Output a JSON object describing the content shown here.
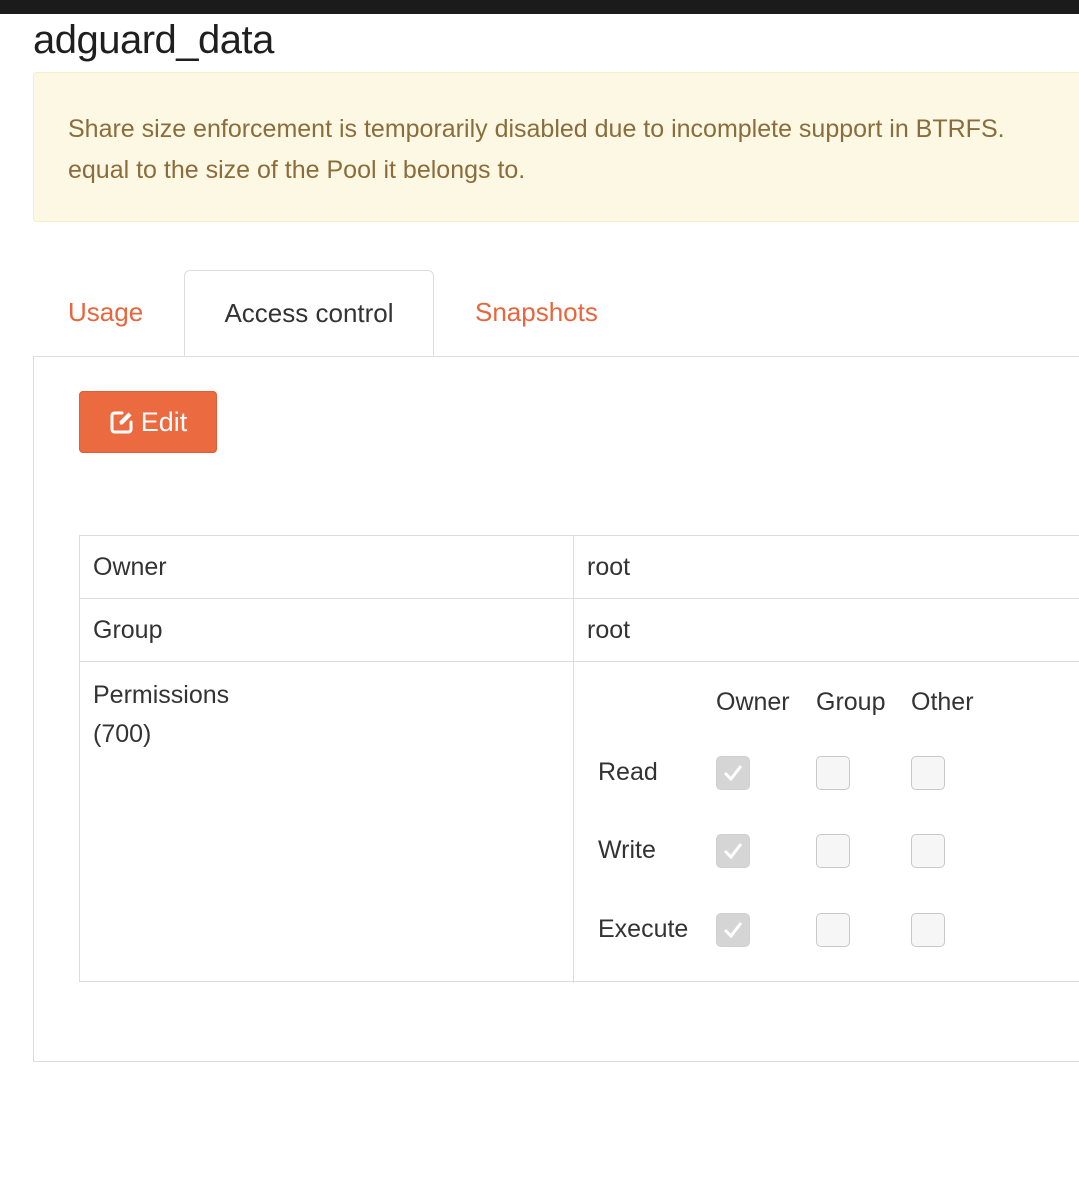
{
  "page": {
    "title": "adguard_data"
  },
  "alert": {
    "line1": "Share size enforcement is temporarily disabled due to incomplete support in BTRFS.",
    "line2": "equal to the size of the Pool it belongs to."
  },
  "tabs": [
    {
      "label": "Usage",
      "active": false
    },
    {
      "label": "Access control",
      "active": true
    },
    {
      "label": "Snapshots",
      "active": false
    }
  ],
  "edit_button": {
    "label": "Edit",
    "icon": "edit-icon"
  },
  "acl": {
    "owner_label": "Owner",
    "owner_value": "root",
    "group_label": "Group",
    "group_value": "root",
    "permissions_label": "Permissions",
    "permissions_code": "(700)",
    "columns": [
      "Owner",
      "Group",
      "Other"
    ],
    "rows": [
      {
        "label": "Read",
        "owner": true,
        "group": false,
        "other": false
      },
      {
        "label": "Write",
        "owner": true,
        "group": false,
        "other": false
      },
      {
        "label": "Execute",
        "owner": true,
        "group": false,
        "other": false
      }
    ]
  },
  "colors": {
    "accent": "#ec6a3f",
    "tab_link": "#e8663d",
    "alert_bg": "#fcf8e3",
    "alert_text": "#8a6d3b"
  }
}
